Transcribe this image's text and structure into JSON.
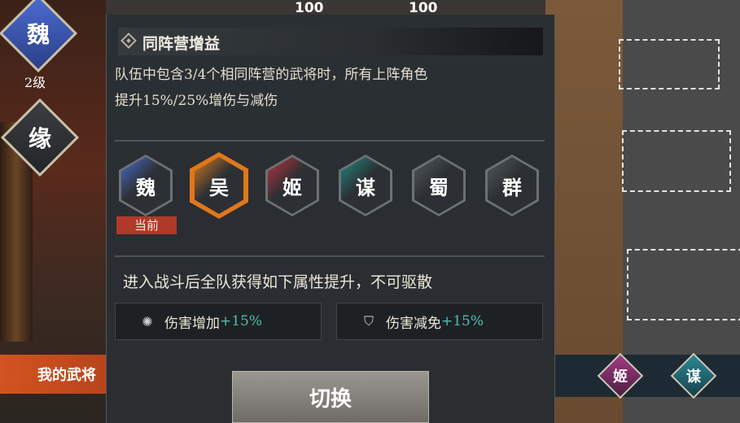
{
  "background": {
    "top_values": [
      "100",
      "100"
    ]
  },
  "left_badges": {
    "faction_label": "魏",
    "level": "2级",
    "fate_label": "缘"
  },
  "panel": {
    "title": "同阵营增益",
    "description_line1": "队伍中包含3/4个相同阵营的武将时，所有上阵角色",
    "description_line2": "提升15%/25%增伤与减伤",
    "factions": [
      {
        "label": "魏",
        "color": "#3e5fb8"
      },
      {
        "label": "吴",
        "color": "#d97a1f"
      },
      {
        "label": "姬",
        "color": "#c2323c"
      },
      {
        "label": "谋",
        "color": "#1f8a80"
      },
      {
        "label": "蜀",
        "color": "#555a5e"
      },
      {
        "label": "群",
        "color": "#555a5e"
      }
    ],
    "current_tag": "当前",
    "bonus_text": "进入战斗后全队获得如下属性提升，不可驱散",
    "stats": [
      {
        "name": "伤害增加",
        "value": "+15%",
        "icon": "gear-burst-icon"
      },
      {
        "name": "伤害减免",
        "value": "+15%",
        "icon": "shield-bolt-icon"
      }
    ],
    "switch_label": "切换"
  },
  "bottom": {
    "my_generals_label": "我的武将",
    "badges": [
      {
        "label": "姬",
        "color": "#8a2f6e"
      },
      {
        "label": "谋",
        "color": "#1f6f7a"
      }
    ]
  }
}
